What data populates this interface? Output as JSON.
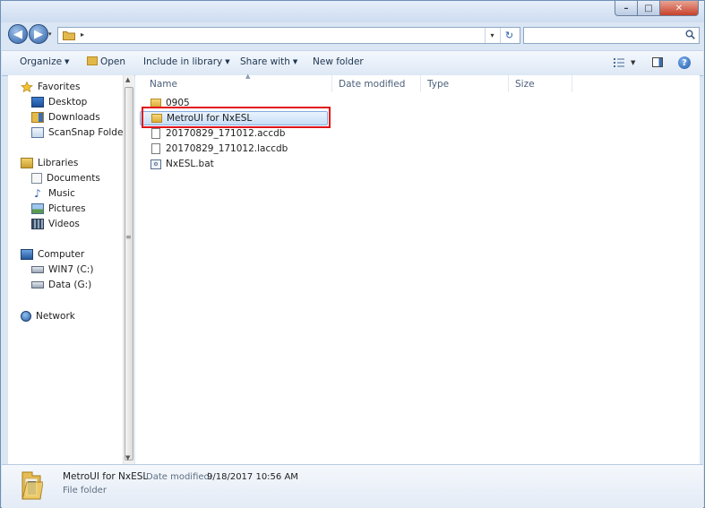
{
  "window": {
    "minimize_glyph": "–",
    "maximize_glyph": "□",
    "close_glyph": "✕"
  },
  "nav": {
    "back_glyph": "◀",
    "forward_glyph": "▶"
  },
  "address": {
    "path_separator": "▸",
    "dropdown_glyph": "▾",
    "refresh_glyph": "↻"
  },
  "search": {
    "placeholder": ""
  },
  "toolbar": {
    "organize": "Organize",
    "open": "Open",
    "include_in_library": "Include in library",
    "share_with": "Share with",
    "new_folder": "New folder",
    "help_glyph": "?"
  },
  "sidebar": {
    "favorites": {
      "label": "Favorites",
      "items": [
        {
          "label": "Desktop",
          "icon": "desktop-icon"
        },
        {
          "label": "Downloads",
          "icon": "downloads-icon"
        },
        {
          "label": "ScanSnap Folder",
          "icon": "scansnap-folder-icon"
        }
      ]
    },
    "libraries": {
      "label": "Libraries",
      "items": [
        {
          "label": "Documents",
          "icon": "documents-icon"
        },
        {
          "label": "Music",
          "icon": "music-icon"
        },
        {
          "label": "Pictures",
          "icon": "pictures-icon"
        },
        {
          "label": "Videos",
          "icon": "videos-icon"
        }
      ]
    },
    "computer": {
      "label": "Computer",
      "items": [
        {
          "label": "WIN7 (C:)",
          "icon": "drive-icon"
        },
        {
          "label": "Data (G:)",
          "icon": "drive-icon"
        }
      ]
    },
    "network": {
      "label": "Network"
    }
  },
  "columns": {
    "name": "Name",
    "date_modified": "Date modified",
    "type": "Type",
    "size": "Size"
  },
  "files": [
    {
      "name": "0905",
      "kind": "folder"
    },
    {
      "name": "MetroUI for NxESL",
      "kind": "folder",
      "selected": true
    },
    {
      "name": "20170829_171012.accdb",
      "kind": "document"
    },
    {
      "name": "20170829_171012.laccdb",
      "kind": "document"
    },
    {
      "name": "NxESL.bat",
      "kind": "batch"
    }
  ],
  "details": {
    "name": "MetroUI for NxESL",
    "date_label": "Date modified:",
    "date_value": "9/18/2017 10:56 AM",
    "type": "File folder"
  },
  "colors": {
    "highlight_border": "#e0121a",
    "selection_fill": "#c6ddf6",
    "close_button": "#c7402a"
  }
}
